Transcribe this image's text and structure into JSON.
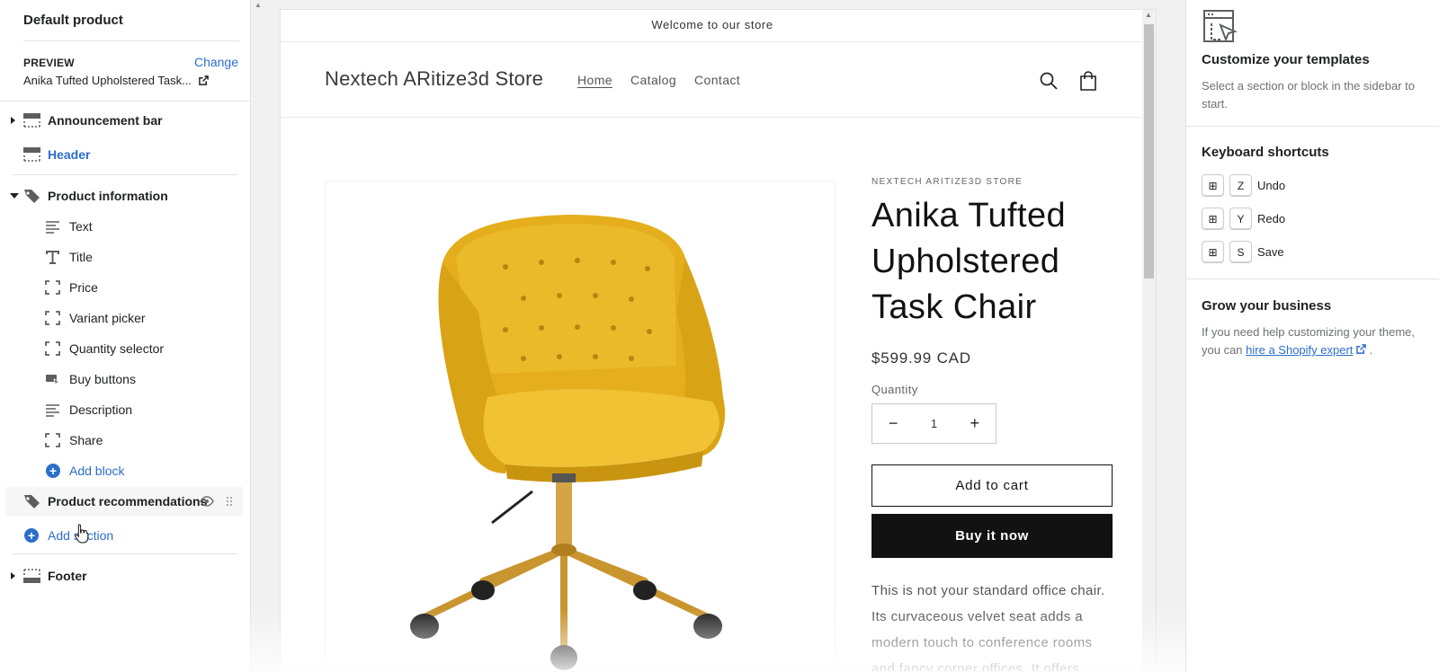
{
  "sidebar": {
    "title": "Default product",
    "preview_label": "PREVIEW",
    "change_label": "Change",
    "preview_product": "Anika Tufted Upholstered Task...",
    "sections": {
      "announcement": "Announcement bar",
      "header": "Header",
      "product_info": "Product information",
      "recommendations": "Product recommendations",
      "footer": "Footer"
    },
    "blocks": [
      "Text",
      "Title",
      "Price",
      "Variant picker",
      "Quantity selector",
      "Buy buttons",
      "Description",
      "Share"
    ],
    "add_block": "Add block",
    "add_section": "Add section"
  },
  "store": {
    "announcement": "Welcome to our store",
    "name": "Nextech ARitize3d Store",
    "nav": [
      "Home",
      "Catalog",
      "Contact"
    ],
    "vendor": "NEXTECH ARITIZE3D STORE",
    "product_title": "Anika Tufted Upholstered Task Chair",
    "price": "$599.99 CAD",
    "quantity_label": "Quantity",
    "quantity_value": "1",
    "minus": "−",
    "plus": "+",
    "add_to_cart": "Add to cart",
    "buy_now": "Buy it now",
    "description": "This is not your standard office chair. Its curvaceous velvet seat adds a modern touch to conference rooms and fancy corner offices. It offers"
  },
  "right_panel": {
    "title": "Customize your templates",
    "subtitle": "Select a section or block in the sidebar to start.",
    "shortcuts_title": "Keyboard shortcuts",
    "shortcuts": [
      {
        "key": "Z",
        "label": "Undo"
      },
      {
        "key": "Y",
        "label": "Redo"
      },
      {
        "key": "S",
        "label": "Save"
      }
    ],
    "modifier_glyph": "⊞",
    "grow_title": "Grow your business",
    "grow_text": "If you need help customizing your theme, you can",
    "grow_link": "hire a Shopify expert",
    "grow_end": "."
  },
  "colors": {
    "accent": "#2c6ecb",
    "button_dark": "#121212",
    "chair_yellow": "#e8b21f",
    "chrome_gold": "#c8952f"
  }
}
